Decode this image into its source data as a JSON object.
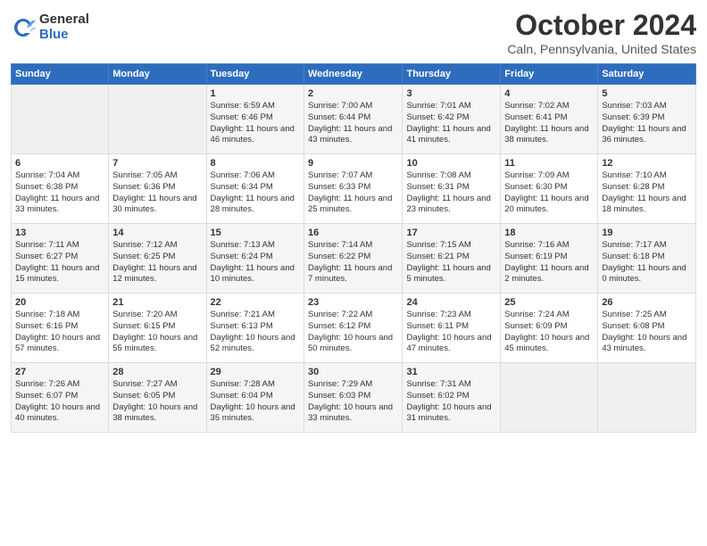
{
  "logo": {
    "general": "General",
    "blue": "Blue"
  },
  "title": "October 2024",
  "subtitle": "Caln, Pennsylvania, United States",
  "weekdays": [
    "Sunday",
    "Monday",
    "Tuesday",
    "Wednesday",
    "Thursday",
    "Friday",
    "Saturday"
  ],
  "weeks": [
    [
      {
        "day": "",
        "info": ""
      },
      {
        "day": "",
        "info": ""
      },
      {
        "day": "1",
        "info": "Sunrise: 6:59 AM\nSunset: 6:46 PM\nDaylight: 11 hours and 46 minutes."
      },
      {
        "day": "2",
        "info": "Sunrise: 7:00 AM\nSunset: 6:44 PM\nDaylight: 11 hours and 43 minutes."
      },
      {
        "day": "3",
        "info": "Sunrise: 7:01 AM\nSunset: 6:42 PM\nDaylight: 11 hours and 41 minutes."
      },
      {
        "day": "4",
        "info": "Sunrise: 7:02 AM\nSunset: 6:41 PM\nDaylight: 11 hours and 38 minutes."
      },
      {
        "day": "5",
        "info": "Sunrise: 7:03 AM\nSunset: 6:39 PM\nDaylight: 11 hours and 36 minutes."
      }
    ],
    [
      {
        "day": "6",
        "info": "Sunrise: 7:04 AM\nSunset: 6:38 PM\nDaylight: 11 hours and 33 minutes."
      },
      {
        "day": "7",
        "info": "Sunrise: 7:05 AM\nSunset: 6:36 PM\nDaylight: 11 hours and 30 minutes."
      },
      {
        "day": "8",
        "info": "Sunrise: 7:06 AM\nSunset: 6:34 PM\nDaylight: 11 hours and 28 minutes."
      },
      {
        "day": "9",
        "info": "Sunrise: 7:07 AM\nSunset: 6:33 PM\nDaylight: 11 hours and 25 minutes."
      },
      {
        "day": "10",
        "info": "Sunrise: 7:08 AM\nSunset: 6:31 PM\nDaylight: 11 hours and 23 minutes."
      },
      {
        "day": "11",
        "info": "Sunrise: 7:09 AM\nSunset: 6:30 PM\nDaylight: 11 hours and 20 minutes."
      },
      {
        "day": "12",
        "info": "Sunrise: 7:10 AM\nSunset: 6:28 PM\nDaylight: 11 hours and 18 minutes."
      }
    ],
    [
      {
        "day": "13",
        "info": "Sunrise: 7:11 AM\nSunset: 6:27 PM\nDaylight: 11 hours and 15 minutes."
      },
      {
        "day": "14",
        "info": "Sunrise: 7:12 AM\nSunset: 6:25 PM\nDaylight: 11 hours and 12 minutes."
      },
      {
        "day": "15",
        "info": "Sunrise: 7:13 AM\nSunset: 6:24 PM\nDaylight: 11 hours and 10 minutes."
      },
      {
        "day": "16",
        "info": "Sunrise: 7:14 AM\nSunset: 6:22 PM\nDaylight: 11 hours and 7 minutes."
      },
      {
        "day": "17",
        "info": "Sunrise: 7:15 AM\nSunset: 6:21 PM\nDaylight: 11 hours and 5 minutes."
      },
      {
        "day": "18",
        "info": "Sunrise: 7:16 AM\nSunset: 6:19 PM\nDaylight: 11 hours and 2 minutes."
      },
      {
        "day": "19",
        "info": "Sunrise: 7:17 AM\nSunset: 6:18 PM\nDaylight: 11 hours and 0 minutes."
      }
    ],
    [
      {
        "day": "20",
        "info": "Sunrise: 7:18 AM\nSunset: 6:16 PM\nDaylight: 10 hours and 57 minutes."
      },
      {
        "day": "21",
        "info": "Sunrise: 7:20 AM\nSunset: 6:15 PM\nDaylight: 10 hours and 55 minutes."
      },
      {
        "day": "22",
        "info": "Sunrise: 7:21 AM\nSunset: 6:13 PM\nDaylight: 10 hours and 52 minutes."
      },
      {
        "day": "23",
        "info": "Sunrise: 7:22 AM\nSunset: 6:12 PM\nDaylight: 10 hours and 50 minutes."
      },
      {
        "day": "24",
        "info": "Sunrise: 7:23 AM\nSunset: 6:11 PM\nDaylight: 10 hours and 47 minutes."
      },
      {
        "day": "25",
        "info": "Sunrise: 7:24 AM\nSunset: 6:09 PM\nDaylight: 10 hours and 45 minutes."
      },
      {
        "day": "26",
        "info": "Sunrise: 7:25 AM\nSunset: 6:08 PM\nDaylight: 10 hours and 43 minutes."
      }
    ],
    [
      {
        "day": "27",
        "info": "Sunrise: 7:26 AM\nSunset: 6:07 PM\nDaylight: 10 hours and 40 minutes."
      },
      {
        "day": "28",
        "info": "Sunrise: 7:27 AM\nSunset: 6:05 PM\nDaylight: 10 hours and 38 minutes."
      },
      {
        "day": "29",
        "info": "Sunrise: 7:28 AM\nSunset: 6:04 PM\nDaylight: 10 hours and 35 minutes."
      },
      {
        "day": "30",
        "info": "Sunrise: 7:29 AM\nSunset: 6:03 PM\nDaylight: 10 hours and 33 minutes."
      },
      {
        "day": "31",
        "info": "Sunrise: 7:31 AM\nSunset: 6:02 PM\nDaylight: 10 hours and 31 minutes."
      },
      {
        "day": "",
        "info": ""
      },
      {
        "day": "",
        "info": ""
      }
    ]
  ]
}
